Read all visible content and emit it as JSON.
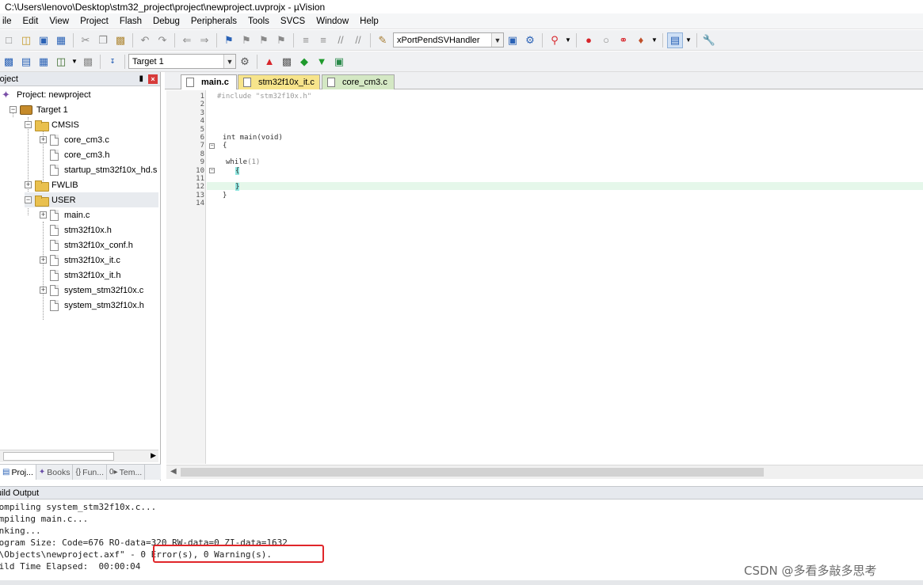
{
  "window": {
    "title": "C:\\Users\\lenovo\\Desktop\\stm32_project\\project\\newproject.uvprojx - µVision"
  },
  "menu": [
    "ile",
    "Edit",
    "View",
    "Project",
    "Flash",
    "Debug",
    "Peripherals",
    "Tools",
    "SVCS",
    "Window",
    "Help"
  ],
  "toolbar1": {
    "function_combo": "xPortPendSVHandler"
  },
  "toolbar2": {
    "target_combo": "Target 1"
  },
  "project_pane": {
    "title": "roject",
    "tree": {
      "root": "Project: newproject",
      "target": "Target 1",
      "groups": [
        {
          "name": "CMSIS",
          "files": [
            "core_cm3.c",
            "core_cm3.h",
            "startup_stm32f10x_hd.s"
          ]
        },
        {
          "name": "FWLIB",
          "files": []
        },
        {
          "name": "USER",
          "files": [
            "main.c",
            "stm32f10x.h",
            "stm32f10x_conf.h",
            "stm32f10x_it.c",
            "stm32f10x_it.h",
            "system_stm32f10x.c",
            "system_stm32f10x.h"
          ]
        }
      ]
    },
    "bottom_tabs": [
      "Proj...",
      "Books",
      "Fun...",
      "Tem..."
    ]
  },
  "editor": {
    "tabs": [
      "main.c",
      "stm32f10x_it.c",
      "core_cm3.c"
    ],
    "line_numbers": [
      "1",
      "2",
      "3",
      "4",
      "5",
      "6",
      "7",
      "8",
      "9",
      "10",
      "11",
      "12",
      "13",
      "14"
    ],
    "code": {
      "include_kw": "#include ",
      "include_file": "\"stm32f10x.h\"",
      "main_sig": "int main(void)",
      "open_brace": "{",
      "while_kw": "while",
      "while_cond": "(1)",
      "inner_open": "{",
      "inner_close": "}",
      "close_brace": "}"
    }
  },
  "build_output": {
    "title": "uild Output",
    "lines": [
      "compiling system_stm32f10x.c...",
      "ompiling main.c...",
      "inking...",
      "rogram Size: Code=676 RO-data=320 RW-data=0 ZI-data=1632",
      ".\\Objects\\newproject.axf\" - 0 Error(s), 0 Warning(s).",
      "uild Time Elapsed:  00:00:04"
    ]
  },
  "watermark": "CSDN @多看多敲多思考",
  "colors": {
    "highlight_line": "#e5f7ea",
    "error_box": "#e0262a",
    "tab_it": "#f7e48b",
    "tab_core": "#d4e8c4"
  }
}
